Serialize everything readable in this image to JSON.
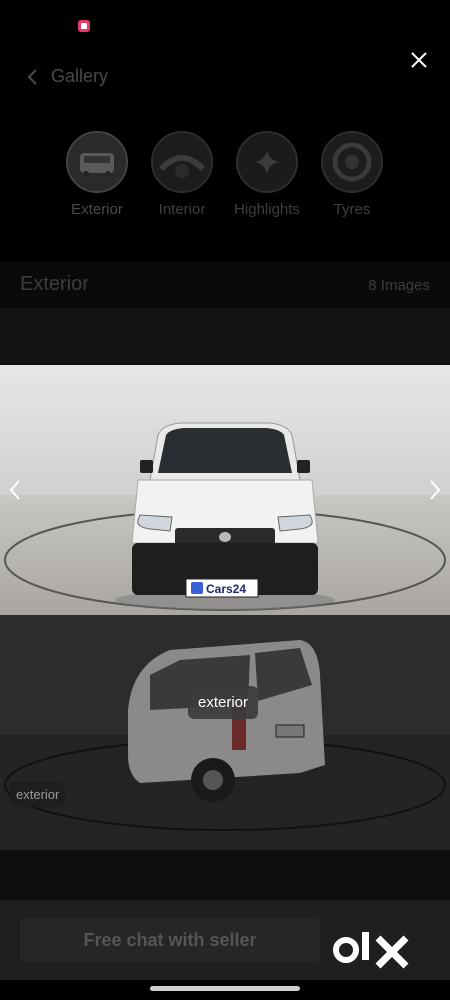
{
  "header": {
    "title": "Gallery"
  },
  "categories": [
    {
      "label": "Exterior",
      "active": true,
      "icon": "exterior-thumbnail"
    },
    {
      "label": "Interior",
      "active": false,
      "icon": "interior-thumbnail"
    },
    {
      "label": "Highlights",
      "active": false,
      "icon": "sparkle-icon"
    },
    {
      "label": "Tyres",
      "active": false,
      "icon": "tyre-thumbnail"
    }
  ],
  "section": {
    "title": "Exterior",
    "count": "8 Images"
  },
  "photo": {
    "plate_brand": "Cars24"
  },
  "overlay": {
    "center_label": "exterior",
    "corner_label": "exterior"
  },
  "bottom": {
    "chat_label": "Free chat with seller",
    "logo_text": "olx"
  },
  "colors": {
    "background": "#000000",
    "accent_status": "#e33a6a"
  }
}
